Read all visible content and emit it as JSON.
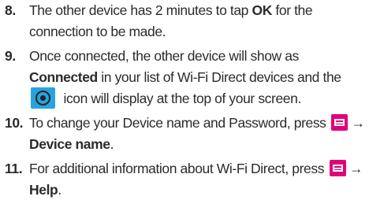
{
  "steps": [
    {
      "number": "8.",
      "t1": "The other device has 2 minutes to tap ",
      "b1": "OK",
      "t2": " for the connection to be made."
    },
    {
      "number": "9.",
      "t1": "Once connected, the other device will show as ",
      "b1": "Connected",
      "t2": " in your list of Wi-Fi Direct devices and the ",
      "icon": "wifi-direct-icon",
      "t3": " icon will display at the top of your screen."
    },
    {
      "number": "10.",
      "t1": "To change your Device name and Password, press ",
      "icon": "menu-icon",
      "b1": " → Device name",
      "t2": "."
    },
    {
      "number": "11.",
      "t1": "For additional information about Wi-Fi Direct, press ",
      "icon": "menu-icon",
      "b1": " → Help",
      "t2": "."
    }
  ],
  "colors": {
    "menu_icon": "#e0007a",
    "wifi_icon": "#27a4e0",
    "text": "#2b2b2b"
  }
}
